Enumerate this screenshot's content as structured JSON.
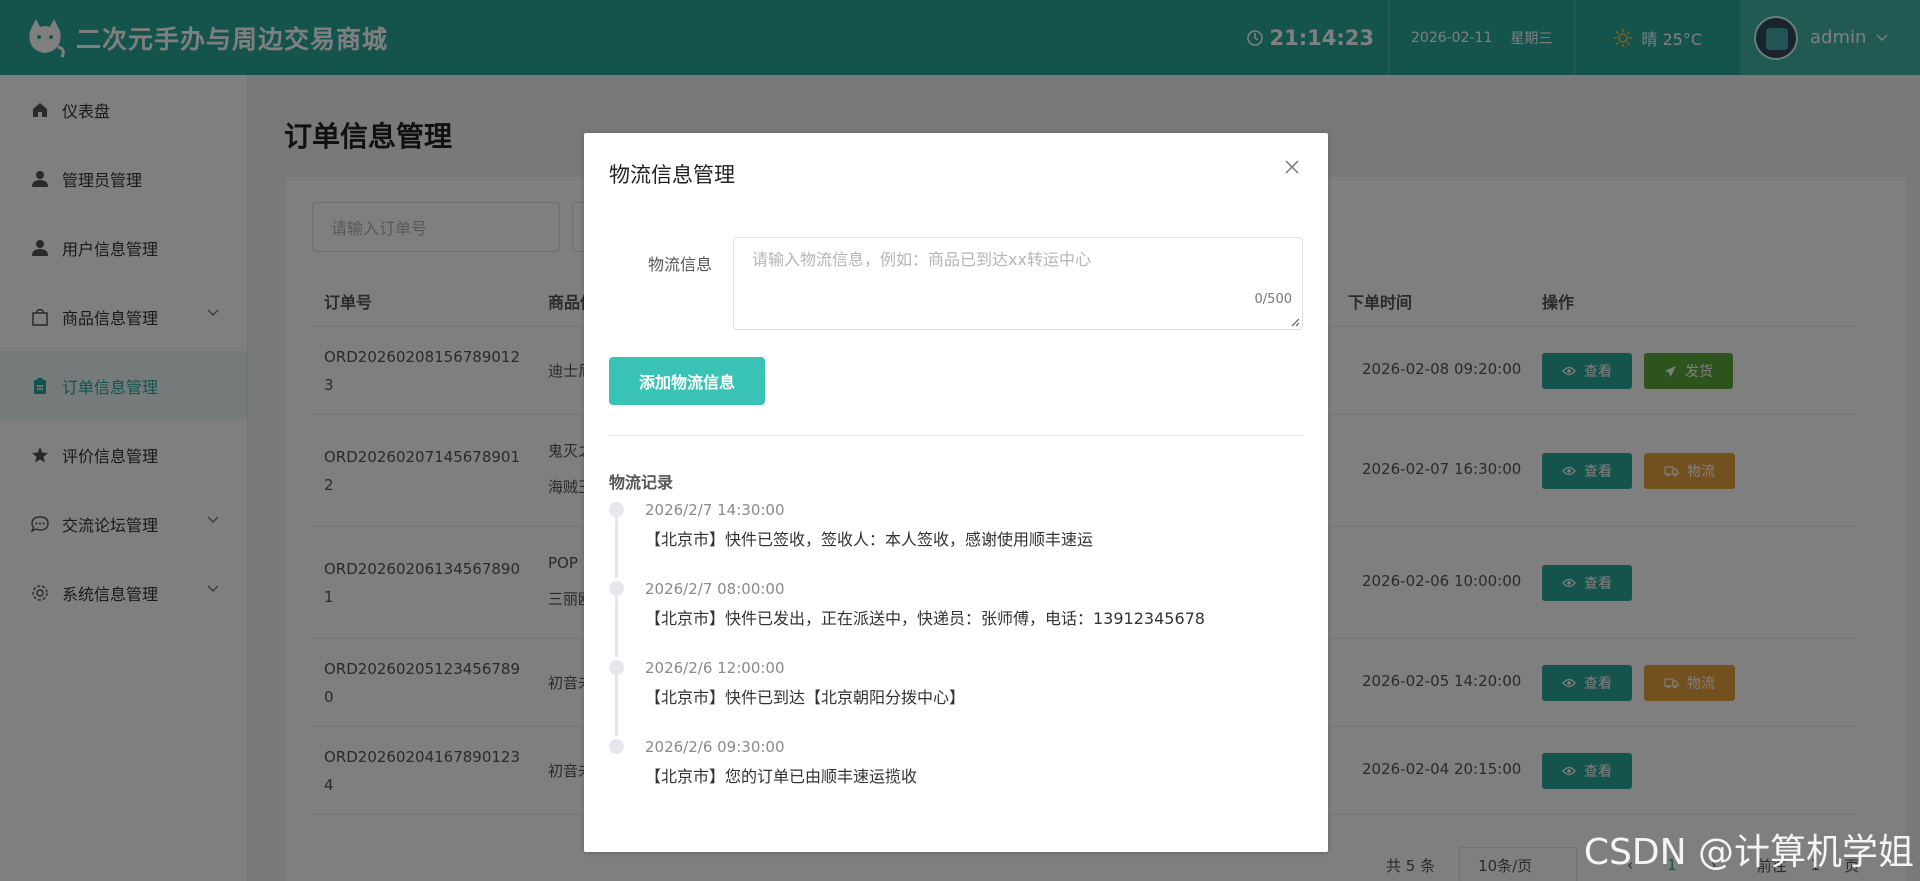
{
  "header": {
    "title": "二次元手办与周边交易商城",
    "time": "21:14:23",
    "date": "2026-02-11",
    "weekday": "星期三",
    "weather": "晴 25°C",
    "user": "admin"
  },
  "sidebar": {
    "items": [
      {
        "label": "仪表盘",
        "icon": "home-icon"
      },
      {
        "label": "管理员管理",
        "icon": "user-icon"
      },
      {
        "label": "用户信息管理",
        "icon": "user-icon"
      },
      {
        "label": "商品信息管理",
        "icon": "bag-icon"
      },
      {
        "label": "订单信息管理",
        "icon": "clipboard-icon",
        "active": true
      },
      {
        "label": "评价信息管理",
        "icon": "star-icon"
      },
      {
        "label": "交流论坛管理",
        "icon": "chat-icon"
      },
      {
        "label": "系统信息管理",
        "icon": "gear-icon"
      }
    ]
  },
  "main": {
    "title": "订单信息管理",
    "search_placeholder": "请输入订单号",
    "columns": {
      "order_no": "订单号",
      "goods": "商品信",
      "time": "下单时间",
      "ops": "操作"
    },
    "rows": [
      {
        "order_no": "ORD202602081567890123",
        "goods": [
          "迪士尼"
        ],
        "time": "2026-02-08 09:20:00",
        "actions": [
          "查看",
          "发货"
        ]
      },
      {
        "order_no": "ORD202602071456789012",
        "goods": [
          "鬼灭之",
          "海贼王"
        ],
        "time": "2026-02-07 16:30:00",
        "actions": [
          "查看",
          "物流"
        ]
      },
      {
        "order_no": "ORD202602061345678901",
        "goods": [
          "POP M",
          "三丽鸥"
        ],
        "time": "2026-02-06 10:00:00",
        "actions": [
          "查看"
        ]
      },
      {
        "order_no": "ORD202602051234567890",
        "goods": [
          "初音未"
        ],
        "time": "2026-02-05 14:20:00",
        "actions": [
          "查看",
          "物流"
        ]
      },
      {
        "order_no": "ORD202602041678901234",
        "goods": [
          "初音未"
        ],
        "time": "2026-02-04 20:15:00",
        "actions": [
          "查看"
        ]
      }
    ],
    "pager": {
      "total": "共 5 条",
      "size": "10条/页",
      "goto": "前往",
      "page": "1",
      "page_unit": "页"
    }
  },
  "dialog": {
    "title": "物流信息管理",
    "field_label": "物流信息",
    "placeholder": "请输入物流信息，例如：商品已到达xx转运中心",
    "counter": "0/500",
    "add_button": "添加物流信息",
    "log_title": "物流记录",
    "logs": [
      {
        "time": "2026/2/7 14:30:00",
        "text": "【北京市】快件已签收，签收人：本人签收，感谢使用顺丰速运"
      },
      {
        "time": "2026/2/7 08:00:00",
        "text": "【北京市】快件已发出，正在派送中，快递员：张师傅，电话：13912345678"
      },
      {
        "time": "2026/2/6 12:00:00",
        "text": "【北京市】快件已到达【北京朝阳分拨中心】"
      },
      {
        "time": "2026/2/6 09:30:00",
        "text": "【北京市】您的订单已由顺丰速运揽收"
      }
    ]
  },
  "watermark": "CSDN @计算机学姐",
  "colors": {
    "primary": "#2aa89b",
    "ship": "#5aa83a",
    "logistics": "#e6a23c",
    "add_button": "#38c3b5"
  }
}
